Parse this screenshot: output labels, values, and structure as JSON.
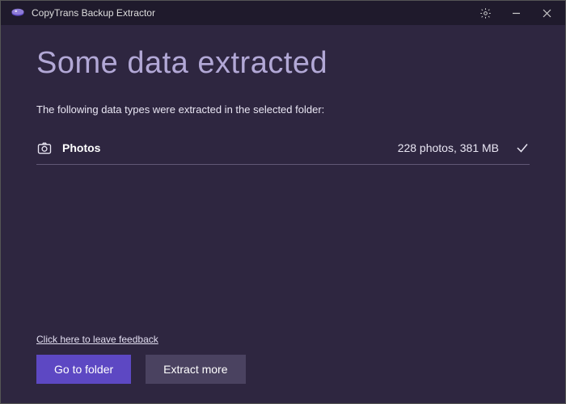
{
  "titlebar": {
    "app_name": "CopyTrans Backup Extractor"
  },
  "headline": "Some data extracted",
  "subtitle": "The following data types were extracted in the selected folder:",
  "items": [
    {
      "name": "Photos",
      "stats": "228 photos, 381 MB"
    }
  ],
  "feedback_link": "Click here to leave feedback",
  "buttons": {
    "primary": "Go to folder",
    "secondary": "Extract more"
  }
}
